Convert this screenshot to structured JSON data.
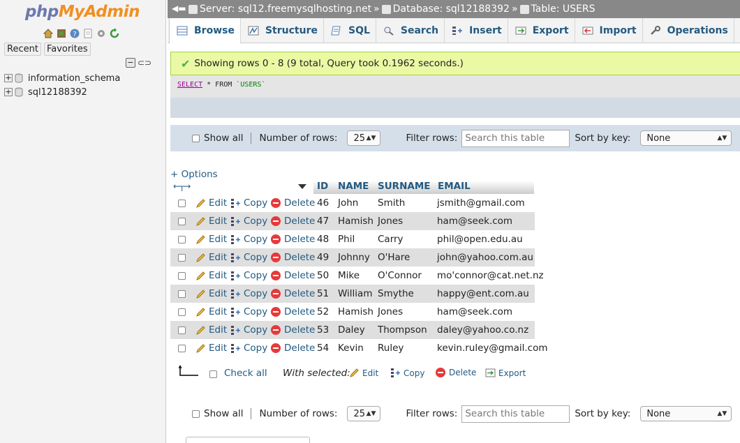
{
  "nav": {
    "logo_php": "php",
    "logo_myadmin": "MyAdmin",
    "tabs": [
      "Recent",
      "Favorites"
    ],
    "databases": [
      "information_schema",
      "sql12188392"
    ],
    "icons": [
      "home-icon",
      "logout-icon",
      "help-icon",
      "docs-icon",
      "settings-icon",
      "reload-icon"
    ]
  },
  "breadcrumb": {
    "server": "Server: sql12.freemysqlhosting.net",
    "database": "Database: sql12188392",
    "table": "Table: USERS",
    "separator": "»"
  },
  "tabs": [
    {
      "label": "Browse",
      "icon": "browse-icon",
      "active": true
    },
    {
      "label": "Structure",
      "icon": "structure-icon"
    },
    {
      "label": "SQL",
      "icon": "sql-icon"
    },
    {
      "label": "Search",
      "icon": "search-icon"
    },
    {
      "label": "Insert",
      "icon": "insert-icon"
    },
    {
      "label": "Export",
      "icon": "export-icon"
    },
    {
      "label": "Import",
      "icon": "import-icon"
    },
    {
      "label": "Operations",
      "icon": "operations-icon"
    }
  ],
  "notice": "Showing rows 0 - 8 (9 total, Query took 0.1962 seconds.)",
  "sql": {
    "keyword": "SELECT",
    "rest": " * FROM ",
    "table": "`USERS`"
  },
  "navbar": {
    "show_all": "Show all",
    "number_of_rows_label": "Number of rows:",
    "number_of_rows": "25",
    "filter_label": "Filter rows:",
    "filter_placeholder": "Search this table",
    "sort_label": "Sort by key:",
    "sort_value": "None"
  },
  "options_label": "+ Options",
  "columns": [
    "ID",
    "NAME",
    "SURNAME",
    "EMAIL"
  ],
  "actions": {
    "edit": "Edit",
    "copy": "Copy",
    "delete": "Delete"
  },
  "rows": [
    {
      "id": "46",
      "name": "John",
      "surname": "Smith",
      "email": "jsmith@gmail.com"
    },
    {
      "id": "47",
      "name": "Hamish",
      "surname": "Jones",
      "email": "ham@seek.com"
    },
    {
      "id": "48",
      "name": "Phil",
      "surname": "Carry",
      "email": "phil@open.edu.au"
    },
    {
      "id": "49",
      "name": "Johnny",
      "surname": "O'Hare",
      "email": "john@yahoo.com.au"
    },
    {
      "id": "50",
      "name": "Mike",
      "surname": "O'Connor",
      "email": "mo'connor@cat.net.nz"
    },
    {
      "id": "51",
      "name": "William",
      "surname": "Smythe",
      "email": "happy@ent.com.au"
    },
    {
      "id": "52",
      "name": "Hamish",
      "surname": "Jones",
      "email": "ham@seek.com"
    },
    {
      "id": "53",
      "name": "Daley",
      "surname": "Thompson",
      "email": "daley@yahoo.co.nz"
    },
    {
      "id": "54",
      "name": "Kevin",
      "surname": "Ruley",
      "email": "kevin.ruley@gmail.com"
    }
  ],
  "with_selected": {
    "check_all": "Check all",
    "label": "With selected:",
    "edit": "Edit",
    "copy": "Copy",
    "delete": "Delete",
    "export": "Export"
  }
}
